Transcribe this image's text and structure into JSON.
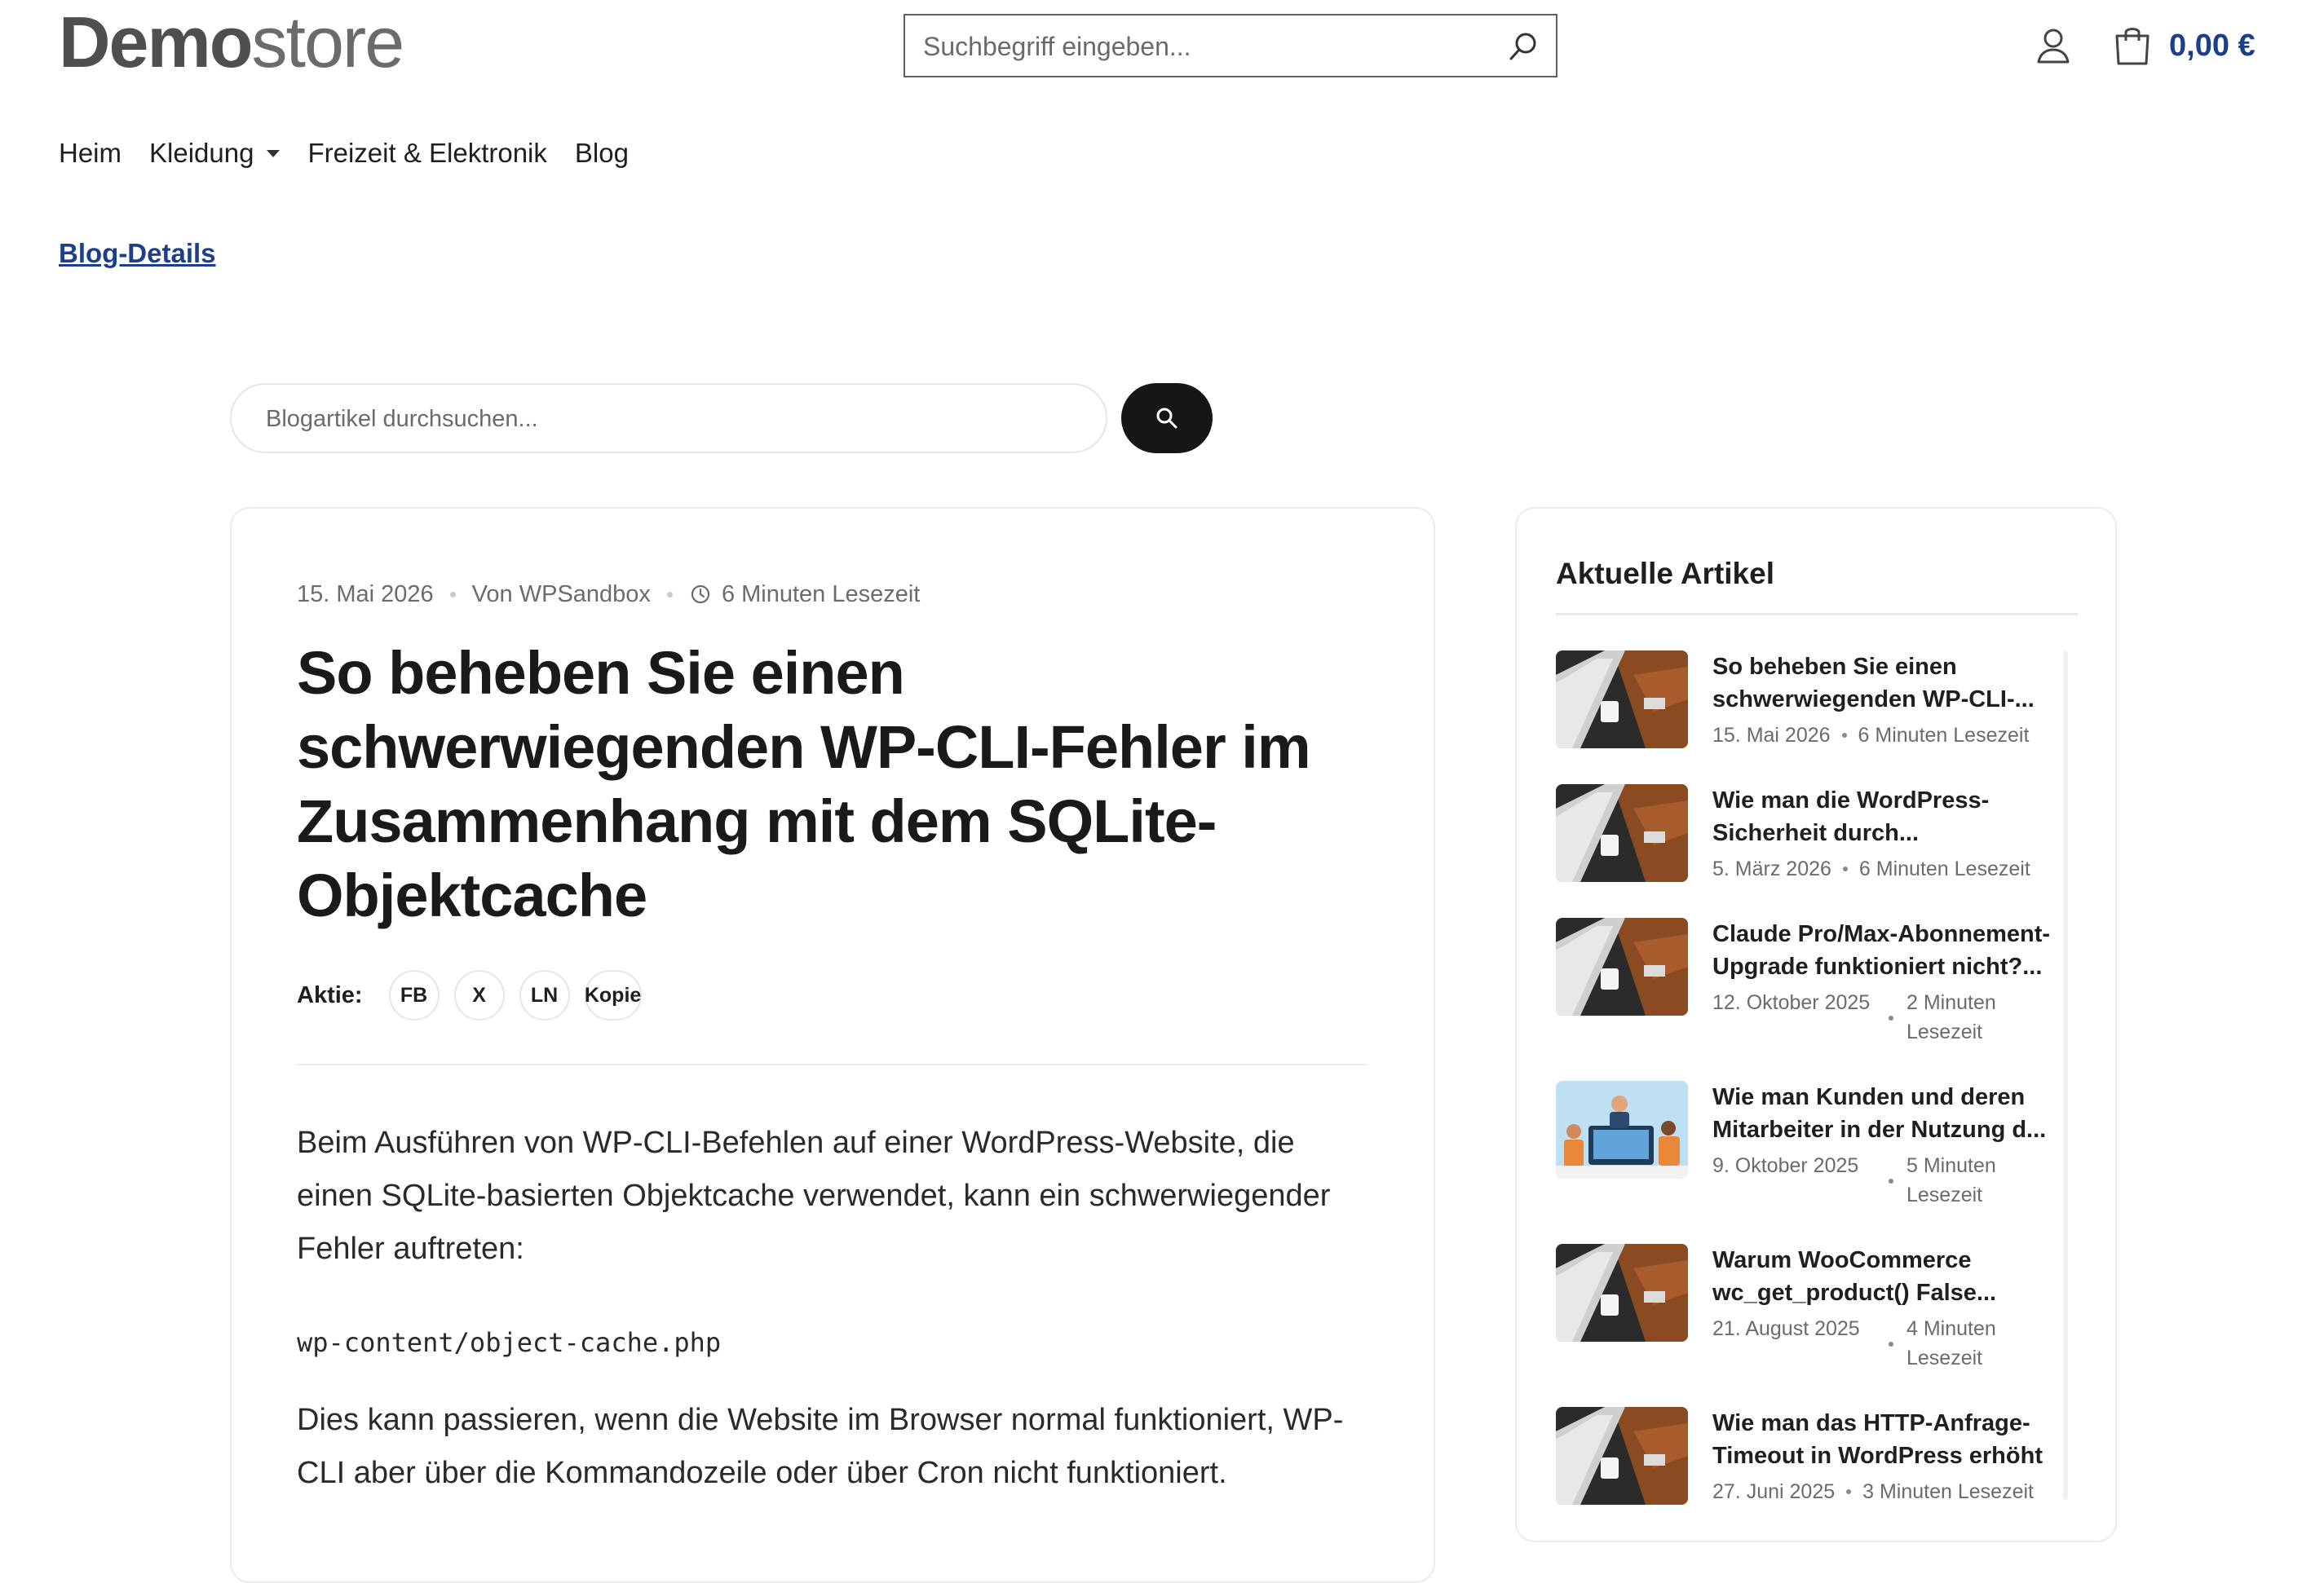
{
  "header": {
    "logo_bold": "Demo",
    "logo_light": "store",
    "search_placeholder": "Suchbegriff eingeben...",
    "cart_total": "0,00 €"
  },
  "nav": {
    "items": [
      {
        "label": "Heim"
      },
      {
        "label": "Kleidung"
      },
      {
        "label": "Freizeit & Elektronik"
      },
      {
        "label": "Blog"
      }
    ]
  },
  "breadcrumb": "Blog-Details",
  "blog_search": {
    "placeholder": "Blogartikel durchsuchen..."
  },
  "article": {
    "date": "15. Mai 2026",
    "author": "Von WPSandbox",
    "read_time": "6 Minuten Lesezeit",
    "title": "So beheben Sie einen schwerwiegenden WP-CLI-Fehler im Zusammenhang mit dem SQLite-Objektcache",
    "share_label": "Aktie:",
    "share": {
      "fb": "FB",
      "x": "X",
      "ln": "LN",
      "copy": "Kopie"
    },
    "p1": "Beim Ausführen von WP-CLI-Befehlen auf einer WordPress-Website, die einen SQLite-basierten Objektcache verwendet, kann ein schwerwiegender Fehler auftreten:",
    "code": "wp-content/object-cache.php",
    "p2": "Dies kann passieren, wenn die Website im Browser normal funktioniert, WP-CLI aber über die Kommandozeile oder über Cron nicht funktioniert."
  },
  "sidebar": {
    "title": "Aktuelle Artikel",
    "posts": [
      {
        "title": "So beheben Sie einen schwerwiegenden WP-CLI-...",
        "date": "15. Mai 2026",
        "read": "6 Minuten Lesezeit",
        "thumb": "desk"
      },
      {
        "title": "Wie man die WordPress-Sicherheit durch...",
        "date": "5. März 2026",
        "read": "6 Minuten Lesezeit",
        "thumb": "desk"
      },
      {
        "title": "Claude Pro/Max-Abonnement-Upgrade funktioniert nicht?...",
        "date": "12. Oktober 2025",
        "read": "2 Minuten Lesezeit",
        "thumb": "desk"
      },
      {
        "title": "Wie man Kunden und deren Mitarbeiter in der Nutzung d...",
        "date": "9. Oktober 2025",
        "read": "5 Minuten Lesezeit",
        "thumb": "meeting"
      },
      {
        "title": "Warum WooCommerce wc_get_product() False...",
        "date": "21. August 2025",
        "read": "4 Minuten Lesezeit",
        "thumb": "desk"
      },
      {
        "title": "Wie man das HTTP-Anfrage-Timeout in WordPress erhöht",
        "date": "27. Juni 2025",
        "read": "3 Minuten Lesezeit",
        "thumb": "desk"
      }
    ]
  },
  "colors": {
    "accent": "#1d3e8a",
    "dark_button": "#161616",
    "border": "#ececec"
  }
}
